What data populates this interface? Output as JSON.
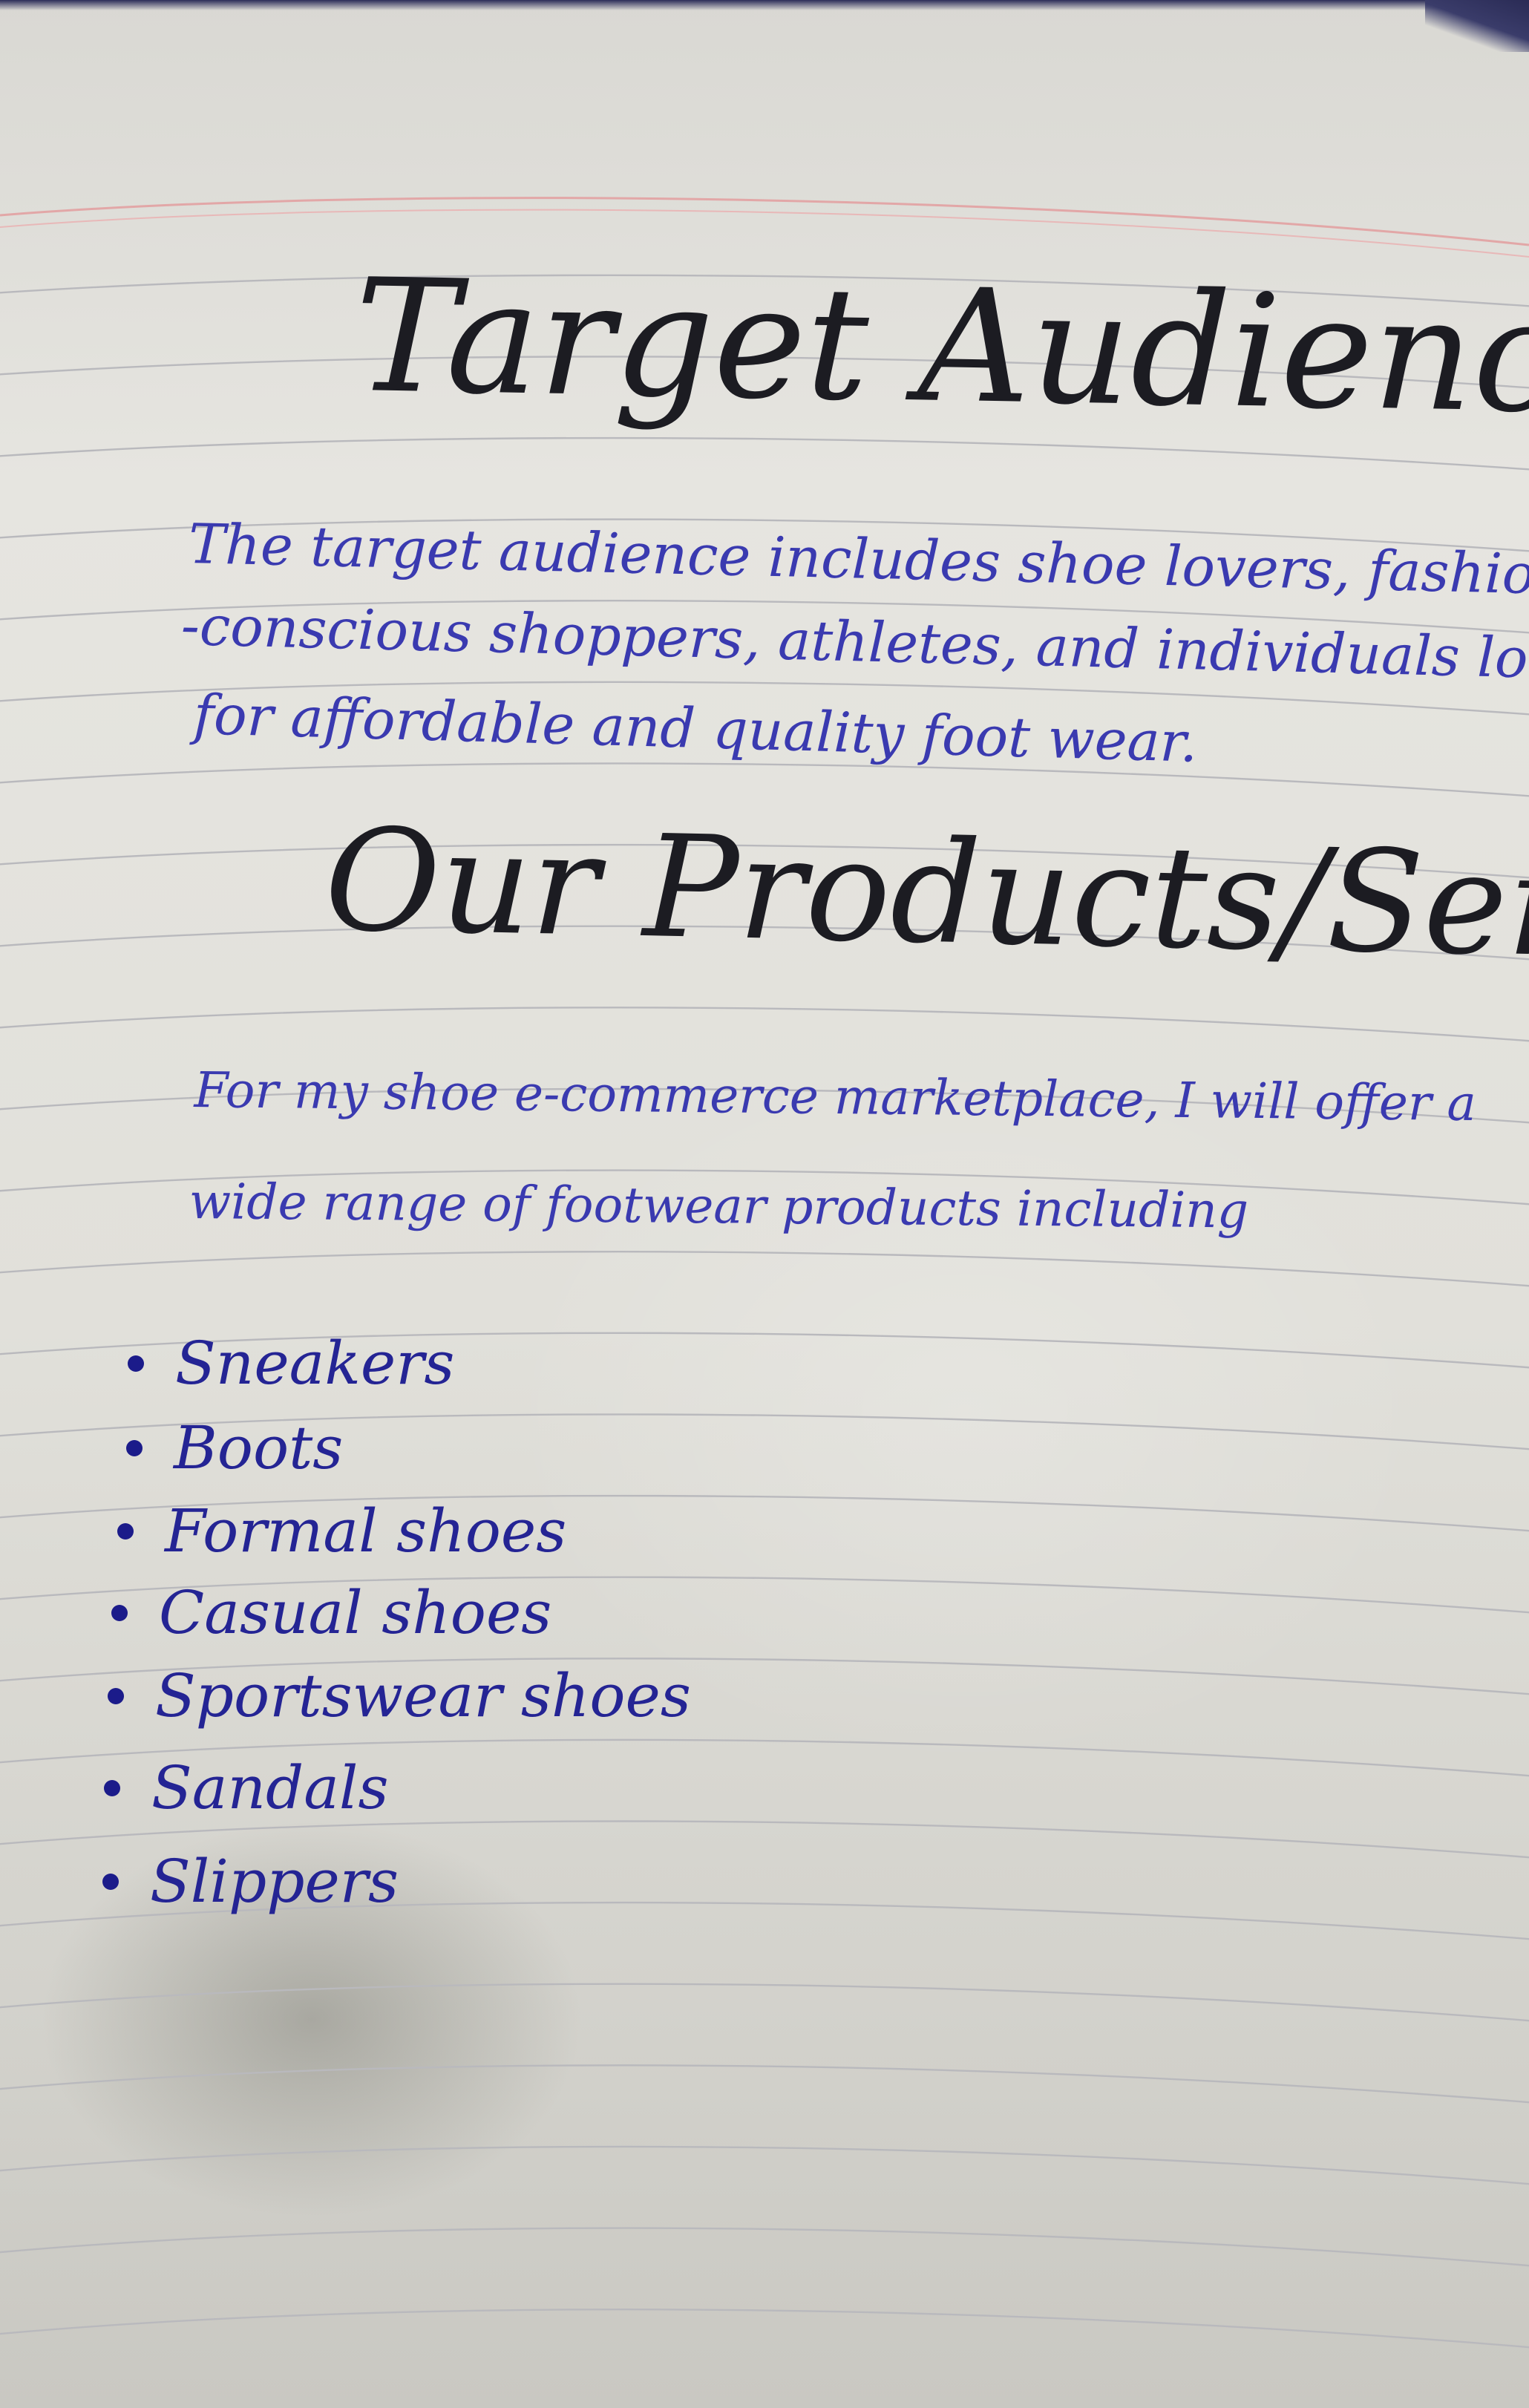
{
  "page": {
    "background": "#e3e2dc",
    "rule_color": "#b9b9bd",
    "margin_line_color": "#e2a7a7",
    "ink_color": "#3a3ab0",
    "heading_ink_color": "#1c1c22"
  },
  "sections": {
    "target_audience": {
      "heading": "Target Audience",
      "lines": [
        "The target audience includes shoe lovers, fashion-",
        "-conscious shoppers, athletes, and individuals looking",
        "for affordable and quality foot wear."
      ]
    },
    "products_services": {
      "heading": "Our Products/Services",
      "lines": [
        "For my shoe e-commerce marketplace, I will offer a",
        "wide range of footwear products including"
      ],
      "items": [
        "Sneakers",
        "Boots",
        "Formal shoes",
        "Casual shoes",
        "Sportswear shoes",
        "Sandals",
        "Slippers"
      ]
    }
  }
}
